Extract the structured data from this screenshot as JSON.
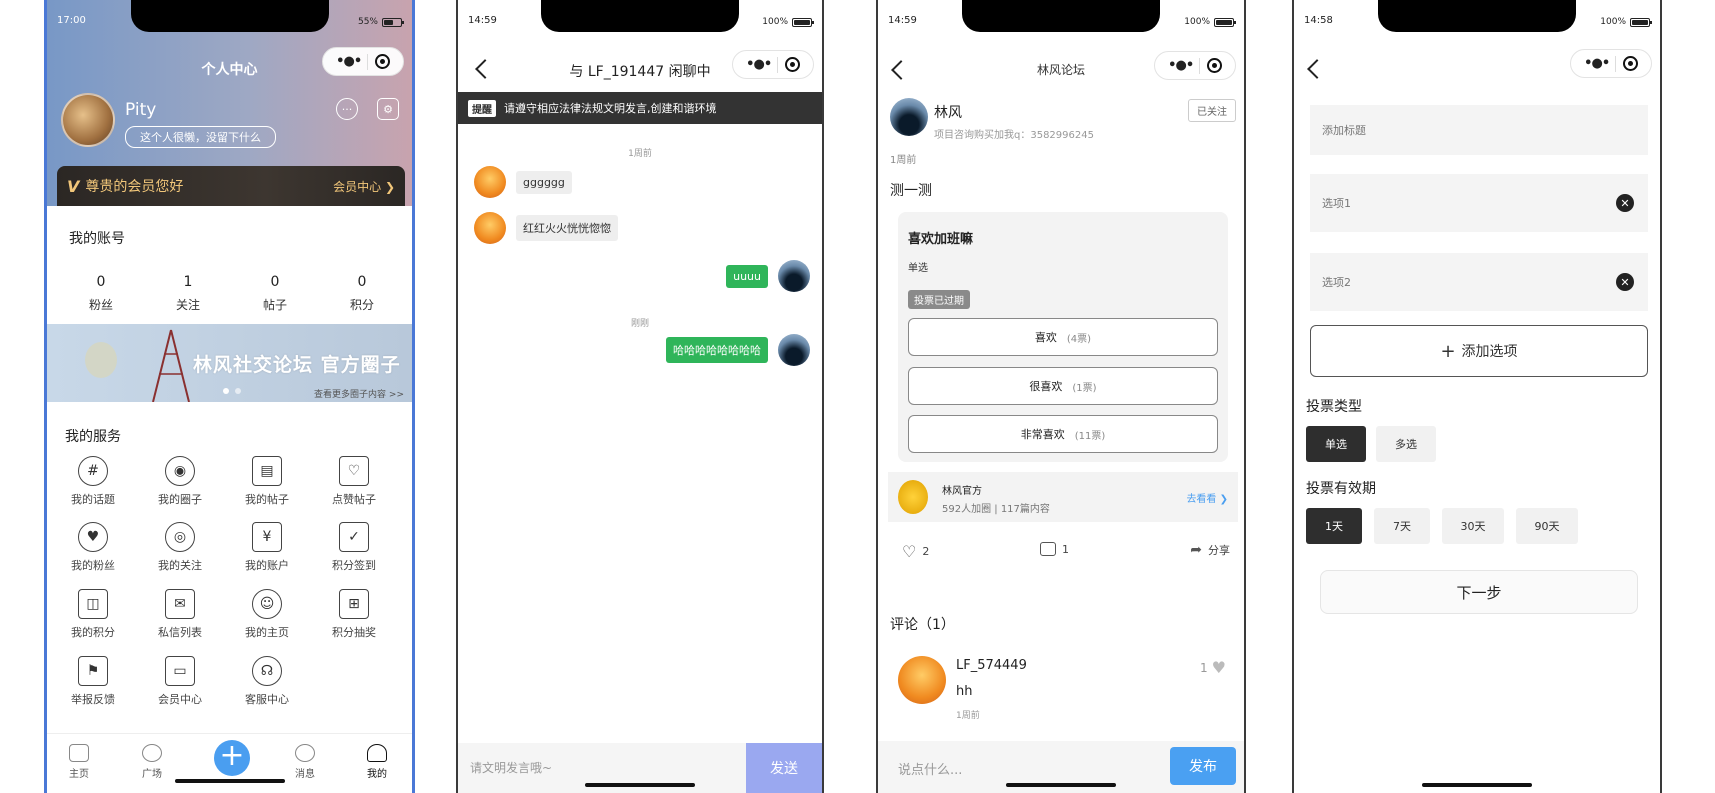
{
  "phone1": {
    "status_time": "17:00",
    "battery": "55%",
    "title": "个人中心",
    "username": "Pity",
    "motto": "这个人很懒，没留下什么",
    "vip_greeting": "尊贵的会员您好",
    "vip_center": "会员中心 ❯",
    "account_title": "我的账号",
    "stats": [
      {
        "num": "0",
        "label": "粉丝"
      },
      {
        "num": "1",
        "label": "关注"
      },
      {
        "num": "0",
        "label": "帖子"
      },
      {
        "num": "0",
        "label": "积分"
      }
    ],
    "banner_text": "林风社交论坛 官方圈子",
    "banner_sub": "查看更多圈子内容 >>",
    "services_title": "我的服务",
    "services": [
      {
        "label": "我的话题",
        "icon": "#"
      },
      {
        "label": "我的圈子",
        "icon": "◉"
      },
      {
        "label": "我的帖子",
        "icon": "▤"
      },
      {
        "label": "点赞帖子",
        "icon": "♡"
      },
      {
        "label": "我的粉丝",
        "icon": "♥"
      },
      {
        "label": "我的关注",
        "icon": "◎"
      },
      {
        "label": "我的账户",
        "icon": "¥"
      },
      {
        "label": "积分签到",
        "icon": "✓"
      },
      {
        "label": "我的积分",
        "icon": "◫"
      },
      {
        "label": "私信列表",
        "icon": "✉"
      },
      {
        "label": "我的主页",
        "icon": "☺"
      },
      {
        "label": "积分抽奖",
        "icon": "⊞"
      },
      {
        "label": "举报反馈",
        "icon": "⚑"
      },
      {
        "label": "会员中心",
        "icon": "▭"
      },
      {
        "label": "客服中心",
        "icon": "☊"
      }
    ],
    "tabs": [
      "主页",
      "广场",
      "消息",
      "我的"
    ]
  },
  "phone2": {
    "status_time": "14:59",
    "battery": "100%",
    "title": "与 LF_191447 闲聊中",
    "notice_tag": "提醒",
    "notice_text": "请遵守相应法律法规文明发言,创建和谐环境",
    "time1": "1周前",
    "msg1": "gggggg",
    "msg2": "红红火火恍恍惚惚",
    "msg3": "uuuu",
    "time2": "刚刚",
    "msg4": "哈哈哈哈哈哈哈哈",
    "input_placeholder": "请文明发言哦~",
    "send": "发送"
  },
  "phone3": {
    "status_time": "14:59",
    "battery": "100%",
    "title": "林风论坛",
    "author": "林风",
    "author_sub": "项目咨询购买加我q：3582996245",
    "follow": "已关注",
    "time": "1周前",
    "heading": "测一测",
    "question": "喜欢加班嘛",
    "vote_type": "单选",
    "expired": "投票已过期",
    "options": [
      {
        "label": "喜欢",
        "count": "(4票)"
      },
      {
        "label": "很喜欢",
        "count": "(1票)"
      },
      {
        "label": "非常喜欢",
        "count": "(11票)"
      }
    ],
    "circle_name": "林风官方",
    "circle_sub": "592人加圈 | 117篇内容",
    "circle_go": "去看看 ❯",
    "likes": "2",
    "comments_count": "1",
    "share": "分享",
    "comments_title": "评论（1）",
    "comment_user": "LF_574449",
    "comment_text": "hh",
    "comment_time": "1周前",
    "comment_likes": "1",
    "input_placeholder": "说点什么...",
    "send": "发布"
  },
  "phone4": {
    "status_time": "14:58",
    "battery": "100%",
    "title_placeholder": "添加标题",
    "option1": "选项1",
    "option2": "选项2",
    "add_option": "添加选项",
    "vote_type_title": "投票类型",
    "types": [
      "单选",
      "多选"
    ],
    "validity_title": "投票有效期",
    "durations": [
      "1天",
      "7天",
      "30天",
      "90天"
    ],
    "next": "下一步"
  }
}
